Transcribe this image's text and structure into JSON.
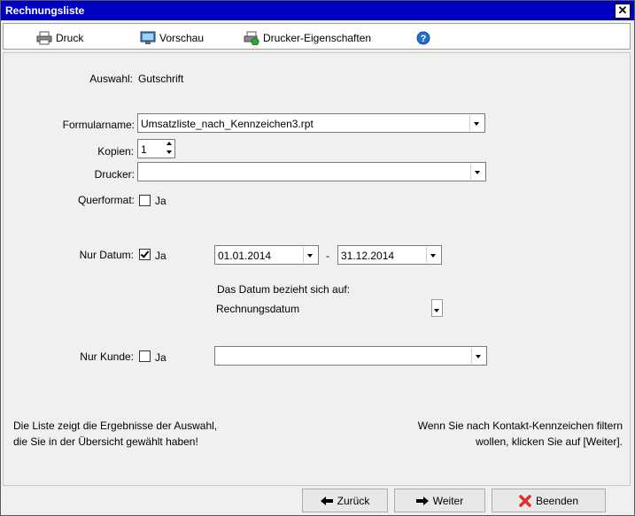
{
  "window": {
    "title": "Rechnungsliste",
    "close_glyph": "✕"
  },
  "toolbar": {
    "druck": "Druck",
    "vorschau": "Vorschau",
    "drucker_eigenschaften": "Drucker-Eigenschaften",
    "help_glyph": "?"
  },
  "form": {
    "auswahl_label": "Auswahl:",
    "auswahl_value": "Gutschrift",
    "formularname_label": "Formularname:",
    "formularname_value": "Umsatzliste_nach_Kennzeichen3.rpt",
    "kopien_label": "Kopien:",
    "kopien_value": "1",
    "drucker_label": "Drucker:",
    "drucker_value": "",
    "querformat_label": "Querformat:",
    "querformat_ja": "Ja",
    "querformat_checked": false,
    "nur_datum_label": "Nur Datum:",
    "nur_datum_ja": "Ja",
    "nur_datum_checked": true,
    "date_from": "01.01.2014",
    "date_sep": "-",
    "date_to": "31.12.2014",
    "datum_bezug_label": "Das Datum bezieht sich auf:",
    "datum_bezug_value": "Rechnungsdatum",
    "nur_kunde_label": "Nur Kunde:",
    "nur_kunde_ja": "Ja",
    "nur_kunde_checked": false,
    "kunde_value": ""
  },
  "info": {
    "left_line1": "Die Liste zeigt die Ergebnisse der Auswahl,",
    "left_line2": "die Sie in der Übersicht gewählt haben!",
    "right_line1": "Wenn Sie nach Kontakt-Kennzeichen filtern",
    "right_line2": "wollen, klicken Sie auf [Weiter]."
  },
  "buttons": {
    "zurueck": "Zurück",
    "weiter": "Weiter",
    "beenden": "Beenden"
  },
  "colors": {
    "titlebar": "#0000c0",
    "close_red": "#e0302a",
    "help_blue": "#1f6fd6"
  }
}
